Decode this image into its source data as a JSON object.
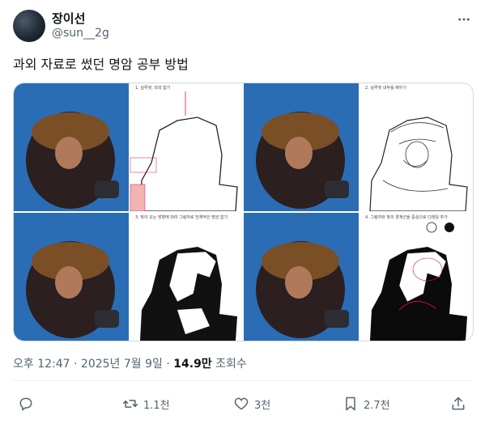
{
  "author": {
    "display_name": "장이선",
    "handle": "@sun__2g"
  },
  "tweet": {
    "text": "과외 자료로 썼던 명암 공부 방법"
  },
  "media": {
    "panels": [
      {
        "step": "1. 실루엣, 외곽 잡기"
      },
      {
        "step": "2. 실루엣 내부를 채우기"
      },
      {
        "step": "3. 빛이 오는 방향에 따라 그림자로 전체적인 명암 잡기"
      },
      {
        "step": "4. 그림자와 빛의 경계선을 중심으로 디테일 추가"
      }
    ]
  },
  "meta": {
    "time": "오후 12:47",
    "date": "2025년 7월 9일",
    "views": "14.9만",
    "views_label": "조회수",
    "separator": "·"
  },
  "actions": {
    "reply": "",
    "retweet": "1.1천",
    "like": "3천",
    "bookmark": "2.7천"
  },
  "icons": [
    "more-icon",
    "reply-icon",
    "retweet-icon",
    "like-icon",
    "bookmark-icon",
    "share-icon"
  ]
}
